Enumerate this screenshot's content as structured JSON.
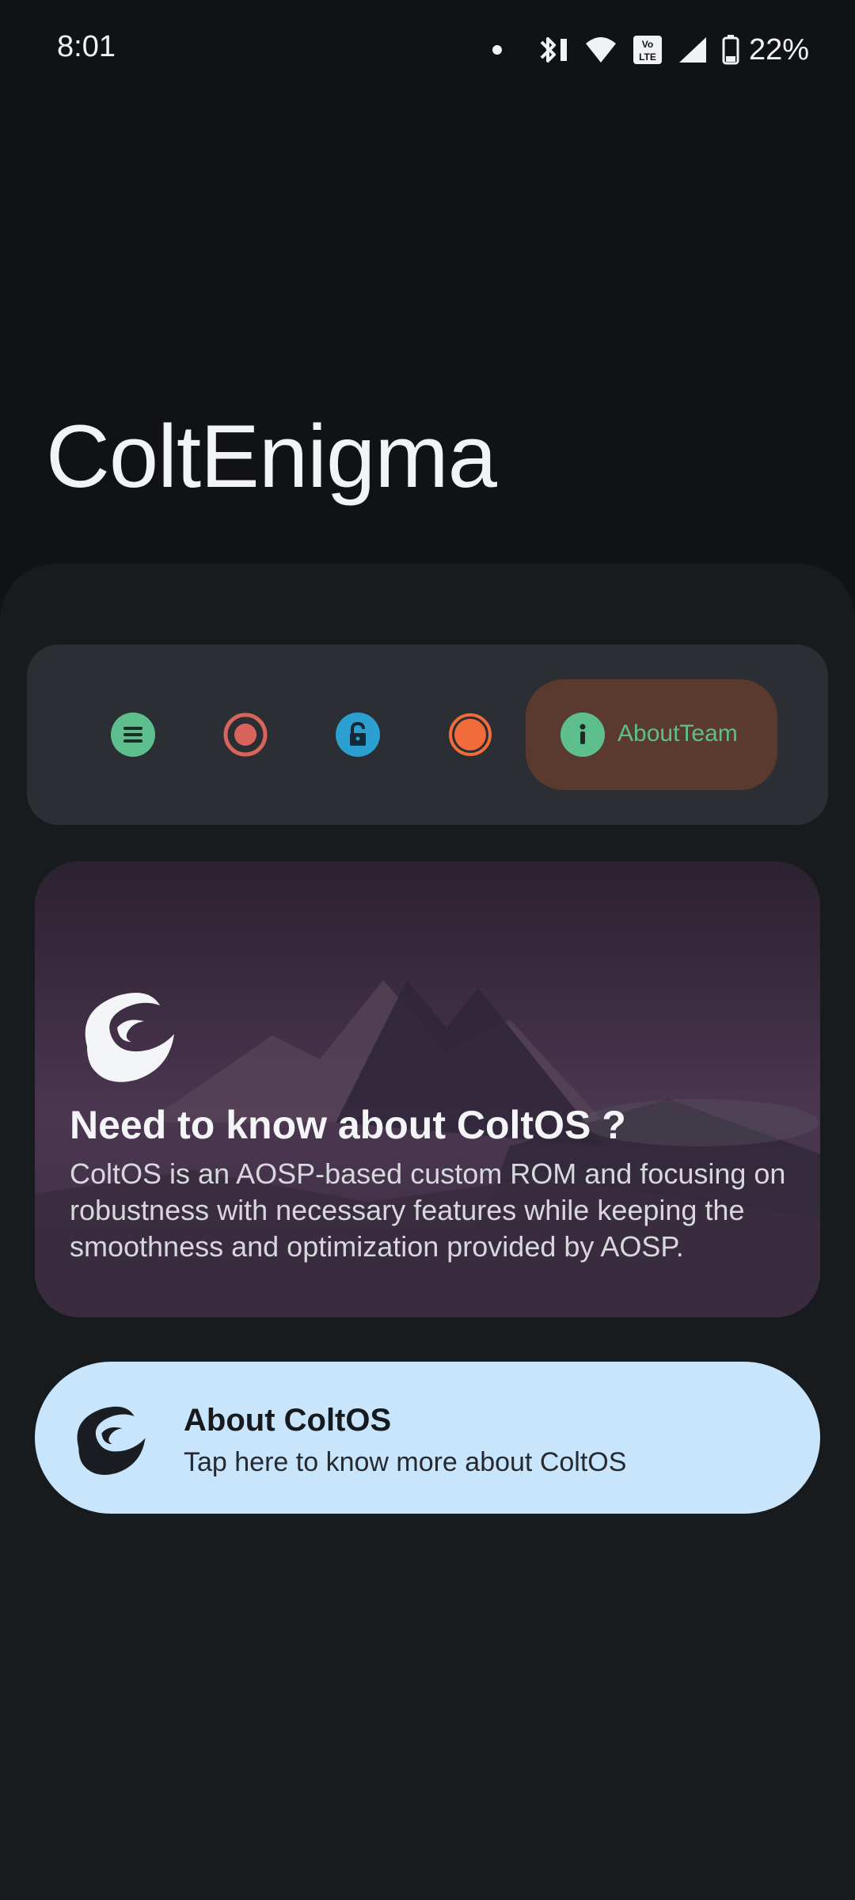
{
  "status_bar": {
    "time": "8:01",
    "battery_percent": "22%",
    "icons": [
      "notification-dot-icon",
      "bluetooth-icon",
      "wifi-icon",
      "volte-icon",
      "cellular-signal-icon",
      "battery-icon"
    ]
  },
  "app": {
    "title": "ColtEnigma"
  },
  "nav": {
    "items": [
      {
        "icon": "menu-list-icon",
        "color": "#5fbf8c"
      },
      {
        "icon": "record-circle-icon",
        "color": "#d9645e"
      },
      {
        "icon": "lock-icon",
        "color": "#2a9fd0"
      },
      {
        "icon": "orange-circle-icon",
        "color": "#f26b3a"
      },
      {
        "icon": "info-icon",
        "color": "#5fbf8c",
        "label": "AboutTeam",
        "active": true
      }
    ],
    "active_bg": "#5a3a2e"
  },
  "info_card": {
    "title": "Need to know about ColtOS ?",
    "body": "ColtOS is an AOSP-based custom ROM and focusing on robustness with necessary features while keeping the smoothness and optimization provided by AOSP."
  },
  "about_card": {
    "title": "About ColtOS",
    "subtitle": "Tap here to know more about ColtOS",
    "bg": "#c8e5fb"
  }
}
